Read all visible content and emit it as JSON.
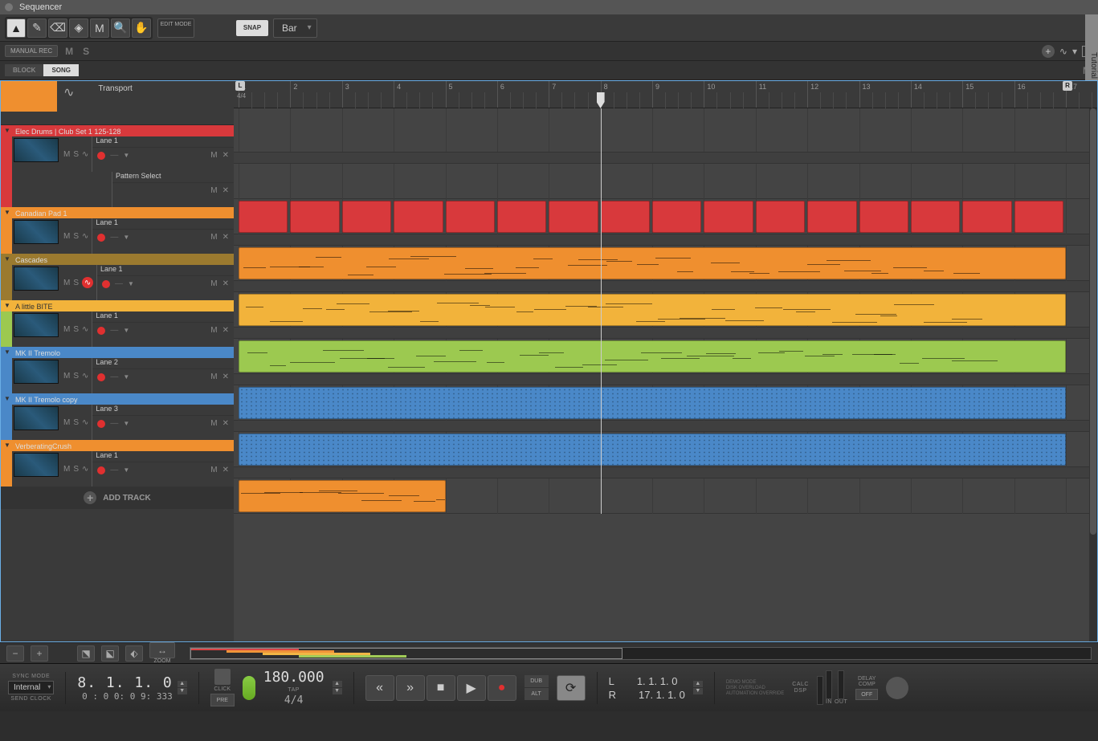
{
  "window": {
    "title": "Sequencer",
    "tutorial_tab": "Tutorial"
  },
  "toolbar": {
    "edit_mode": "EDIT\nMODE",
    "snap_label": "SNAP",
    "snap_value": "Bar"
  },
  "toolbar2": {
    "manual_rec": "MANUAL REC",
    "m": "M",
    "s": "S"
  },
  "toolbar3": {
    "block": "BLOCK",
    "song": "SONG",
    "m": "M"
  },
  "ruler": {
    "timesig": "4/4",
    "ticks": [
      1,
      2,
      3,
      4,
      5,
      6,
      7,
      8,
      9,
      10,
      11,
      12,
      13,
      14,
      15,
      16,
      17
    ],
    "loop_left": "L",
    "loop_right": "R",
    "playhead_bar": 8
  },
  "tracks": [
    {
      "name": "Transport",
      "color": "c-orange",
      "type": "transport"
    },
    {
      "name": "Elec Drums | Club  Set 1  125-128",
      "color": "c-red",
      "lanes": [
        {
          "name": "Lane 1",
          "clips": []
        },
        {
          "name": "Pattern Select",
          "clips": [
            {
              "start": 1,
              "end": 17,
              "cls": "clip-red",
              "segmented": true
            }
          ]
        }
      ]
    },
    {
      "name": "Canadian Pad 1",
      "color": "c-orange",
      "lanes": [
        {
          "name": "Lane 1",
          "clips": [
            {
              "start": 1,
              "end": 17,
              "cls": "clip-orange",
              "notes": true
            }
          ]
        }
      ]
    },
    {
      "name": "Cascades",
      "color": "c-olive",
      "recHighlight": true,
      "lanes": [
        {
          "name": "Lane 1",
          "clips": [
            {
              "start": 1,
              "end": 17,
              "cls": "clip-yellow",
              "notes": true
            }
          ]
        }
      ]
    },
    {
      "name": "A little BITE",
      "color": "c-green",
      "titleClass": "c-yellow-title",
      "lanes": [
        {
          "name": "Lane 1",
          "clips": [
            {
              "start": 1,
              "end": 17,
              "cls": "clip-green",
              "notes": true
            }
          ]
        }
      ]
    },
    {
      "name": "MK II Tremolo",
      "color": "c-blue",
      "lanes": [
        {
          "name": "Lane 2",
          "clips": [
            {
              "start": 1,
              "end": 17,
              "cls": "clip-blue",
              "texture": true
            }
          ]
        }
      ]
    },
    {
      "name": "MK II Tremolo copy",
      "color": "c-blue",
      "lanes": [
        {
          "name": "Lane 3",
          "clips": [
            {
              "start": 1,
              "end": 17,
              "cls": "clip-blue",
              "texture": true
            }
          ]
        }
      ]
    },
    {
      "name": "VerberatingCrush",
      "color": "c-orange",
      "lanes": [
        {
          "name": "Lane 1",
          "clips": [
            {
              "start": 1,
              "end": 5,
              "cls": "clip-orange",
              "notes": true
            }
          ]
        }
      ]
    }
  ],
  "add_track": "ADD TRACK",
  "nav": {
    "zoom_label": "ZOOM"
  },
  "transport": {
    "sync_mode_label": "SYNC MODE",
    "sync_mode_value": "Internal",
    "send_clock": "SEND CLOCK",
    "position_bars": "8.  1.  1.    0",
    "position_time": "0 : 0 0: 0 9: 333",
    "click_label": "CLICK",
    "pre_label": "PRE",
    "tempo": "180.000",
    "tap": "TAP",
    "timesig": "4/4",
    "dub": "DUB",
    "alt": "ALT",
    "L": "L",
    "R": "R",
    "L_pos": "1.  1.  1.    0",
    "R_pos": "17.  1.  1.    0",
    "meter_labels": [
      "DEMO MODE",
      "DISK OVERLOAD",
      "AUTOMATION OVERRIDE"
    ],
    "calc": "CALC",
    "dsp": "DSP",
    "in": "IN",
    "out": "OUT",
    "delay_comp": "DELAY\nCOMP",
    "off": "OFF"
  }
}
